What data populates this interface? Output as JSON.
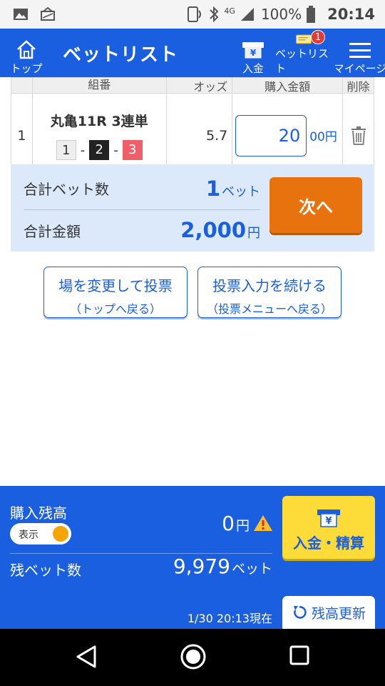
{
  "status_bar": {
    "signal": "4G",
    "battery": "100%",
    "time": "20:14"
  },
  "header": {
    "title": "ベットリスト",
    "nav": {
      "home": "トップ",
      "deposit": "入金",
      "betlist": "ベットリスト",
      "betlist_badge": "1",
      "mypage": "マイページ"
    }
  },
  "bet_table": {
    "columns": [
      "",
      "組番",
      "オッズ",
      "購入金額",
      "削除"
    ],
    "rows": [
      {
        "no": "1",
        "race": "丸亀11R 3連単",
        "combo": [
          "1",
          "2",
          "3"
        ],
        "separator": "-",
        "odds": "5.7",
        "amount": "20",
        "amount_unit": "00円"
      }
    ]
  },
  "summary": {
    "total_bets_label": "合計ベット数",
    "total_bets_value": "1",
    "total_bets_unit": "ベット",
    "total_amount_label": "合計金額",
    "total_amount_value": "2,000",
    "total_amount_unit": "円",
    "next_button": "次へ"
  },
  "actions": {
    "change_venue_main": "場を変更して投票",
    "change_venue_sub": "（トップへ戻る）",
    "continue_main": "投票入力を続ける",
    "continue_sub": "（投票メニューへ戻る）"
  },
  "balance": {
    "purchase_balance_label": "購入残高",
    "toggle_label": "表示",
    "balance_value": "0",
    "balance_unit": "円",
    "remaining_bets_label": "残ベット数",
    "remaining_bets_value": "9,979",
    "remaining_bets_unit": "ベット",
    "deposit_button": "入金・精算",
    "timestamp": "1/30 20:13現在",
    "refresh_button": "残高更新"
  },
  "colors": {
    "primary": "#1a5fe0",
    "accent_orange": "#e8730e",
    "accent_yellow": "#fddc3a",
    "summary_bg": "#dce9fb"
  }
}
